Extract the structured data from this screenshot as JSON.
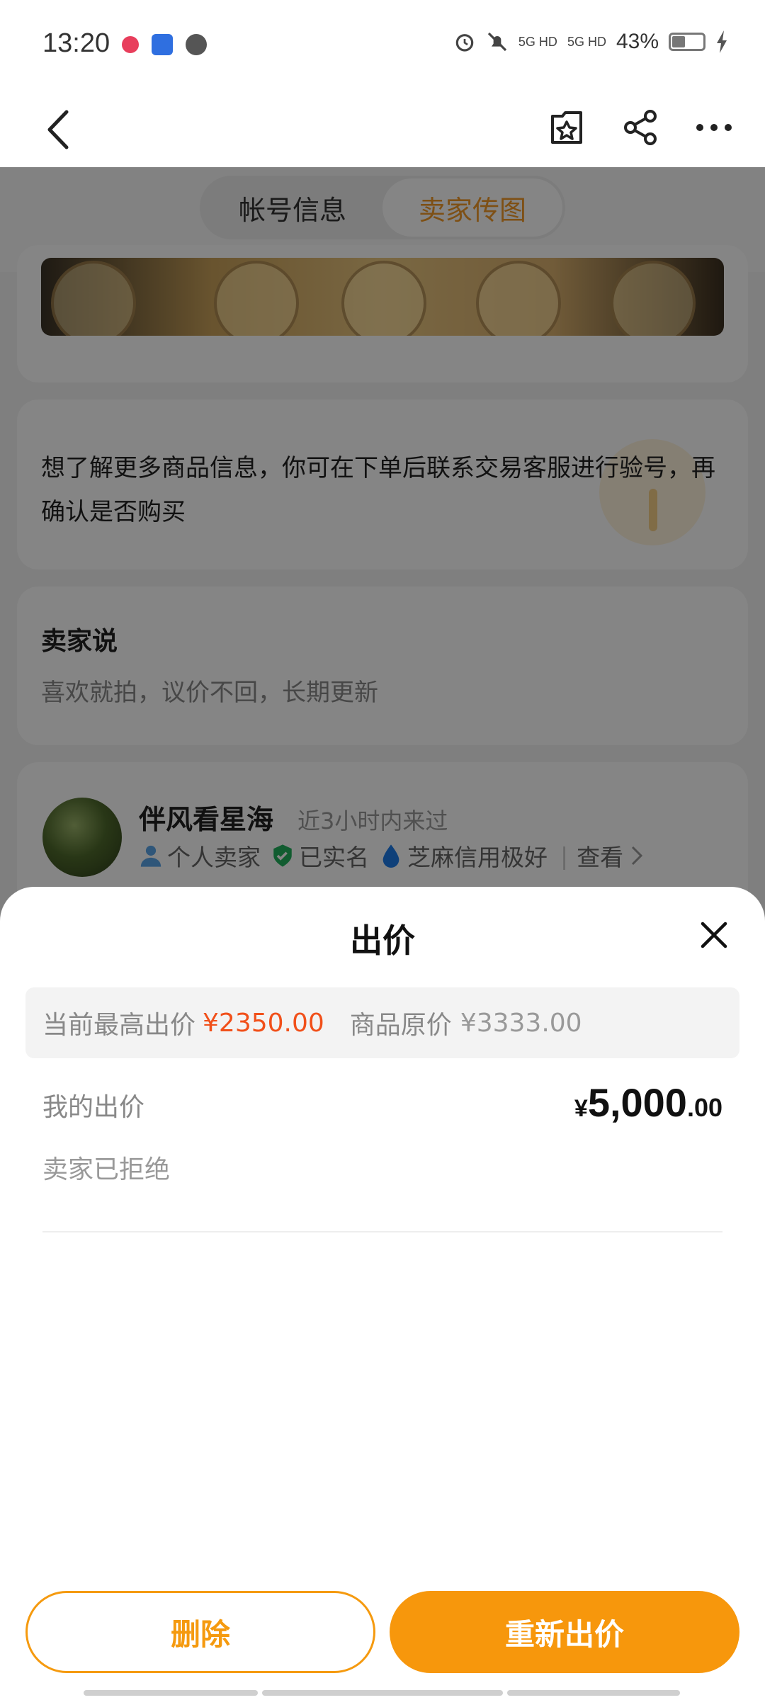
{
  "status_bar": {
    "time": "13:20",
    "network_1": "5G HD",
    "network_2": "5G HD",
    "battery_percent": "43%"
  },
  "nav": {
    "back_icon": "chevron-left-icon",
    "favorite_icon": "star-bookmark-icon",
    "share_icon": "share-icon",
    "more_icon": "more-horizontal-icon"
  },
  "tabs": [
    {
      "label": "帐号信息",
      "active": false
    },
    {
      "label": "卖家传图",
      "active": true
    }
  ],
  "info": {
    "text": "想了解更多商品信息，你可在下单后联系交易客服进行验号，再确认是否购买"
  },
  "seller_say": {
    "title": "卖家说",
    "text": "喜欢就拍，议价不回，长期更新"
  },
  "seller": {
    "name": "伴风看星海",
    "last_visit": "近3小时内来过",
    "tag_personal": "个人卖家",
    "tag_verified": "已实名",
    "tag_credit": "芝麻信用极好",
    "view_link": "查看"
  },
  "bid_sheet": {
    "title": "出价",
    "highest_bid_label": "当前最高出价",
    "highest_bid_value": "¥2350.00",
    "original_price_label": "商品原价",
    "original_price_value": "¥3333.00",
    "my_bid_label": "我的出价",
    "my_bid_currency": "¥",
    "my_bid_integer": "5,000",
    "my_bid_decimal": ".00",
    "status": "卖家已拒绝",
    "delete_label": "删除",
    "rebid_label": "重新出价"
  },
  "colors": {
    "accent": "#f7970c",
    "price_highlight": "#f1501a"
  }
}
